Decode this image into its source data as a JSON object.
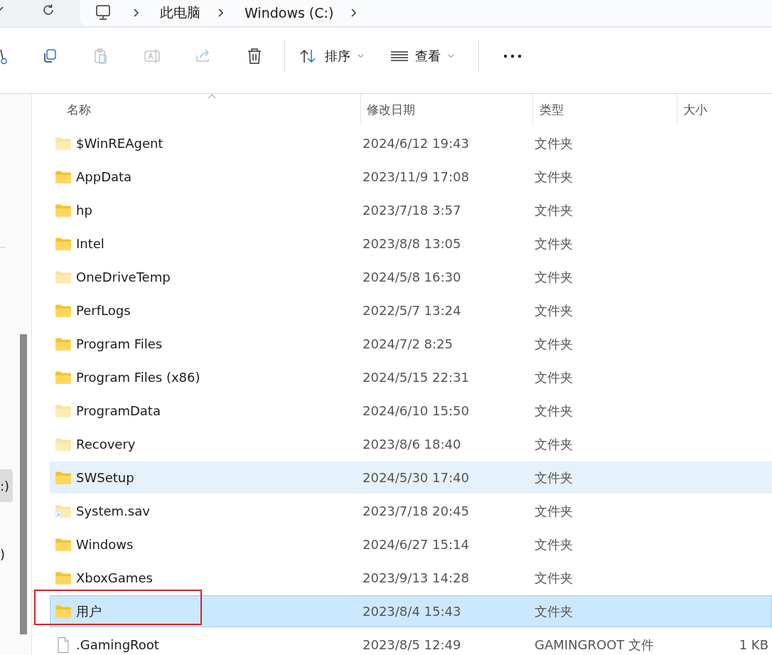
{
  "address_bar": {
    "crumbs": [
      "此电脑",
      "Windows (C:)"
    ]
  },
  "toolbar": {
    "buttons": [
      {
        "kind": "cut",
        "disabled": false
      },
      {
        "kind": "copy",
        "disabled": false
      },
      {
        "kind": "paste",
        "disabled": true
      },
      {
        "kind": "rename",
        "disabled": true
      },
      {
        "kind": "share",
        "disabled": true
      },
      {
        "kind": "delete",
        "disabled": false
      }
    ],
    "sort": {
      "label": "排序"
    },
    "view": {
      "label": "查看"
    }
  },
  "sidebar": {
    "items": [
      {
        "label": ":)",
        "selected": true
      },
      {
        "label": ")",
        "selected": false
      }
    ]
  },
  "table": {
    "columns": [
      "名称",
      "修改日期",
      "类型",
      "大小"
    ],
    "rows": [
      {
        "name": "$WinREAgent",
        "date": "2024/6/12 19:43",
        "type": "文件夹",
        "kind": "folder",
        "hidden": true,
        "hovered": false,
        "selected": false,
        "marked": false
      },
      {
        "name": "AppData",
        "date": "2023/11/9 17:08",
        "type": "文件夹",
        "kind": "folder",
        "hidden": false,
        "hovered": false,
        "selected": false,
        "marked": false
      },
      {
        "name": "hp",
        "date": "2023/7/18 3:57",
        "type": "文件夹",
        "kind": "folder",
        "hidden": false,
        "hovered": false,
        "selected": false,
        "marked": false
      },
      {
        "name": "Intel",
        "date": "2023/8/8 13:05",
        "type": "文件夹",
        "kind": "folder",
        "hidden": false,
        "hovered": false,
        "selected": false,
        "marked": false
      },
      {
        "name": "OneDriveTemp",
        "date": "2024/5/8 16:30",
        "type": "文件夹",
        "kind": "folder",
        "hidden": true,
        "hovered": false,
        "selected": false,
        "marked": false
      },
      {
        "name": "PerfLogs",
        "date": "2022/5/7 13:24",
        "type": "文件夹",
        "kind": "folder",
        "hidden": false,
        "hovered": false,
        "selected": false,
        "marked": false
      },
      {
        "name": "Program Files",
        "date": "2024/7/2 8:25",
        "type": "文件夹",
        "kind": "folder",
        "hidden": false,
        "hovered": false,
        "selected": false,
        "marked": false
      },
      {
        "name": "Program Files (x86)",
        "date": "2024/5/15 22:31",
        "type": "文件夹",
        "kind": "folder",
        "hidden": false,
        "hovered": false,
        "selected": false,
        "marked": false
      },
      {
        "name": "ProgramData",
        "date": "2024/6/10 15:50",
        "type": "文件夹",
        "kind": "folder",
        "hidden": true,
        "hovered": false,
        "selected": false,
        "marked": false
      },
      {
        "name": "Recovery",
        "date": "2023/8/6 18:40",
        "type": "文件夹",
        "kind": "folder",
        "hidden": true,
        "hovered": false,
        "selected": false,
        "marked": false
      },
      {
        "name": "SWSetup",
        "date": "2024/5/30 17:40",
        "type": "文件夹",
        "kind": "folder",
        "hidden": false,
        "hovered": true,
        "selected": false,
        "marked": false
      },
      {
        "name": "System.sav",
        "date": "2023/7/18 20:45",
        "type": "文件夹",
        "kind": "shortcut",
        "hidden": true,
        "hovered": false,
        "selected": false,
        "marked": false
      },
      {
        "name": "Windows",
        "date": "2024/6/27 15:14",
        "type": "文件夹",
        "kind": "folder",
        "hidden": false,
        "hovered": false,
        "selected": false,
        "marked": false
      },
      {
        "name": "XboxGames",
        "date": "2023/9/13 14:28",
        "type": "文件夹",
        "kind": "folder",
        "hidden": false,
        "hovered": false,
        "selected": false,
        "marked": false
      },
      {
        "name": "用户",
        "date": "2023/8/4 15:43",
        "type": "文件夹",
        "kind": "folder",
        "hidden": false,
        "hovered": false,
        "selected": true,
        "marked": true
      },
      {
        "name": ".GamingRoot",
        "date": "2023/8/5 12:49",
        "type": "GAMINGROOT 文件",
        "size": "1 KB",
        "kind": "file",
        "hidden": false,
        "hovered": false,
        "selected": false,
        "marked": false
      }
    ]
  }
}
